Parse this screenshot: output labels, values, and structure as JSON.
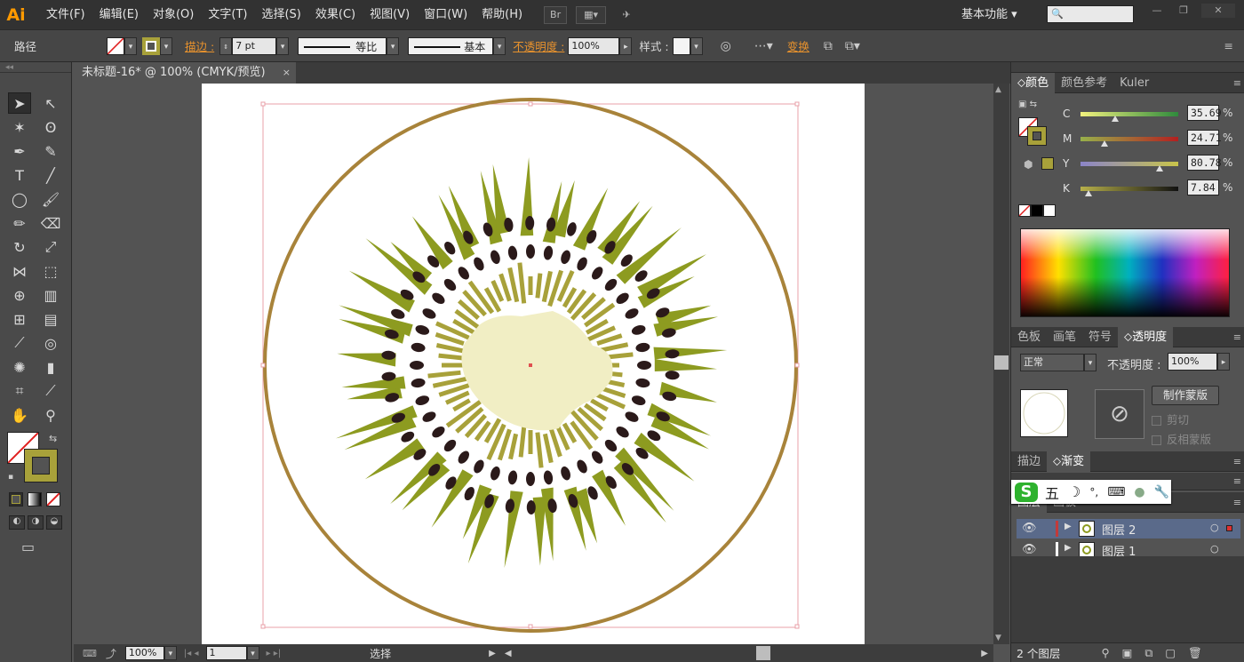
{
  "app": {
    "logo": "Ai"
  },
  "menu": [
    "文件(F)",
    "编辑(E)",
    "对象(O)",
    "文字(T)",
    "选择(S)",
    "效果(C)",
    "视图(V)",
    "窗口(W)",
    "帮助(H)"
  ],
  "workspace": {
    "label": "基本功能 ▾",
    "search_placeholder": "🔍"
  },
  "control": {
    "selection_label": "路径",
    "stroke_label": "描边 :",
    "stroke_weight": "7 pt",
    "profile_uniform": "等比",
    "brush_basic": "基本",
    "opacity_label": "不透明度 :",
    "opacity_value": "100%",
    "style_label": "样式 :",
    "transform_label": "变换",
    "stroke_color": "#a8a13a"
  },
  "document": {
    "tab_title": "未标题-16* @ 100% (CMYK/预览)",
    "close": "×"
  },
  "status": {
    "zoom": "100%",
    "artboard_num": "1",
    "tool_label": "选择"
  },
  "color_panel": {
    "tabs": [
      "颜色",
      "颜色参考",
      "Kuler"
    ],
    "active_tab": 0,
    "channels": [
      {
        "label": "C",
        "value": "35.69",
        "pct": 0.3569,
        "track": "linear-gradient(to right,#f2f27e,#2f8a3c)"
      },
      {
        "label": "M",
        "value": "24.71",
        "pct": 0.2471,
        "track": "linear-gradient(to right,#97b04a,#b32020)"
      },
      {
        "label": "Y",
        "value": "80.78",
        "pct": 0.8078,
        "track": "linear-gradient(to right,#8b84c9,#c8c44a)"
      },
      {
        "label": "K",
        "value": "7.84",
        "pct": 0.0784,
        "track": "linear-gradient(to right,#b7b04a,#111111)"
      }
    ],
    "pct_sign": "%",
    "current_color": "#a8a13a"
  },
  "transparency_panel": {
    "tabs": [
      "色板",
      "画笔",
      "符号",
      "透明度"
    ],
    "active_tab": 3,
    "blend_mode": "正常",
    "opacity_label": "不透明度 :",
    "opacity_value": "100%",
    "make_mask": "制作蒙版",
    "clip": "剪切",
    "invert_mask": "反相蒙版"
  },
  "stroke_panel": {
    "tabs": [
      "描边",
      "渐变"
    ],
    "active_tab": 1
  },
  "layers_panel": {
    "tabs": [
      "图层",
      "画板"
    ],
    "layers": [
      {
        "name": "图层 2",
        "color": "#c23a3a",
        "selected": true
      },
      {
        "name": "图层 1",
        "color": "#ffffff",
        "selected": false
      }
    ],
    "count": "2 个图层"
  },
  "ime": {
    "wubi": "五"
  },
  "artwork": {
    "rim_color": "#a8833a",
    "flesh_color": "#8d9b20",
    "seed_color": "#2b1a1a",
    "fiber_color": "#a8a13a",
    "core_color": "#f1eec4"
  }
}
